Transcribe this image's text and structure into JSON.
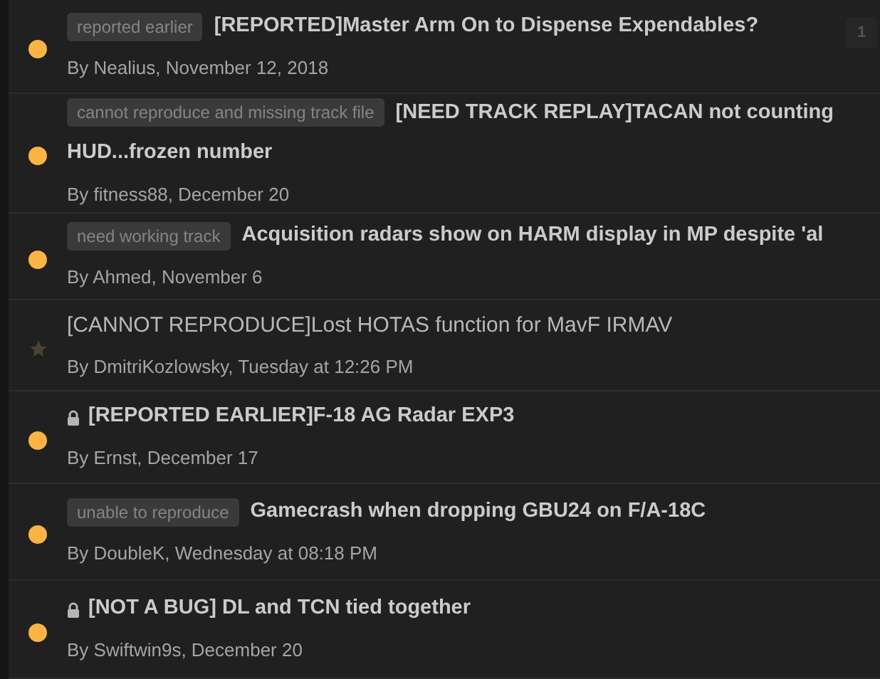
{
  "topics": [
    {
      "unread": true,
      "locked": false,
      "tag": "reported earlier",
      "title_lines": [
        "[REPORTED]Master Arm On to Dispense Expendables?"
      ],
      "byline": "By Nealius, November 12, 2018",
      "pages": [
        "1"
      ]
    },
    {
      "unread": true,
      "locked": false,
      "tag": "cannot reproduce and missing track file",
      "title_lines": [
        "[NEED TRACK REPLAY]TACAN not counting",
        "HUD...frozen number"
      ],
      "byline": "By fitness88, December 20"
    },
    {
      "unread": true,
      "locked": false,
      "tag": "need working track",
      "title_lines": [
        "Acquisition radars show on HARM display in MP despite 'al"
      ],
      "byline": "By Ahmed, November 6"
    },
    {
      "unread": false,
      "locked": false,
      "title_lines": [
        "[CANNOT REPRODUCE]Lost HOTAS function for MavF IRMAV"
      ],
      "byline": "By DmitriKozlowsky, Tuesday at 12:26 PM"
    },
    {
      "unread": true,
      "locked": true,
      "title_lines": [
        "[REPORTED EARLIER]F-18 AG Radar EXP3"
      ],
      "byline": "By Ernst, December 17"
    },
    {
      "unread": true,
      "locked": false,
      "tag": "unable to reproduce",
      "title_lines": [
        "Gamecrash when dropping GBU24 on F/A-18C"
      ],
      "byline": "By DoubleK, Wednesday at 08:18 PM"
    },
    {
      "unread": true,
      "locked": true,
      "title_lines": [
        "[NOT A BUG] DL and TCN tied together"
      ],
      "byline": "By Swiftwin9s, December 20"
    }
  ]
}
